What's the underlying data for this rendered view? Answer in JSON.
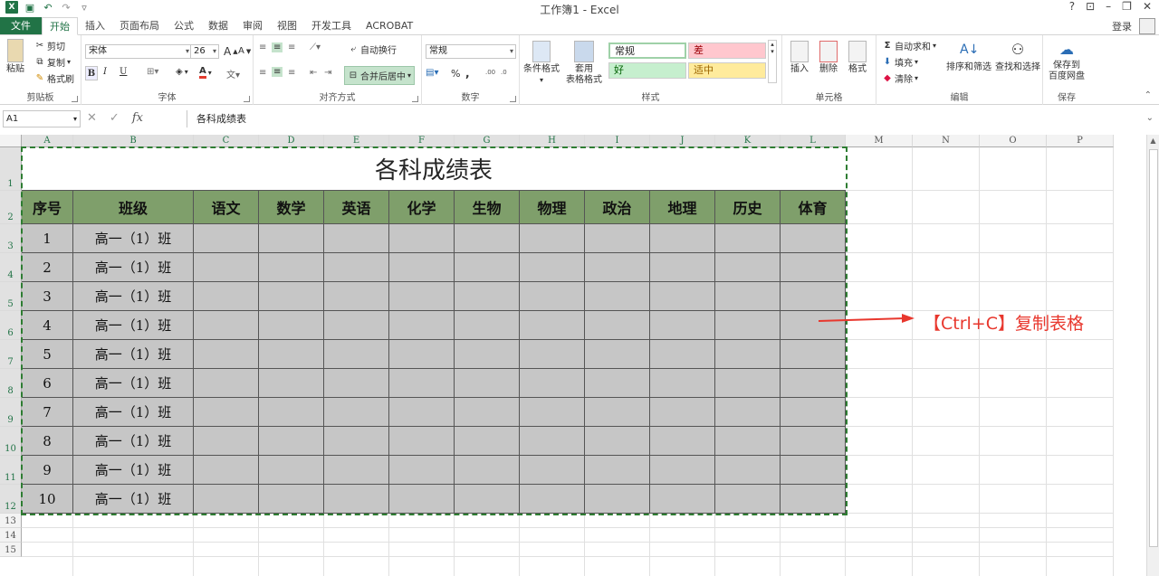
{
  "window": {
    "title": "工作簿1 - Excel",
    "controls": [
      "?",
      "⊡",
      "–",
      "❐",
      "✕"
    ]
  },
  "tabs": {
    "file": "文件",
    "items": [
      "开始",
      "插入",
      "页面布局",
      "公式",
      "数据",
      "审阅",
      "视图",
      "开发工具",
      "ACROBAT"
    ],
    "active": "开始",
    "signin": "登录"
  },
  "ribbon": {
    "clipboard": {
      "paste": "粘贴",
      "cut": "剪切",
      "copy": "复制",
      "format_painter": "格式刷",
      "label": "剪贴板"
    },
    "font": {
      "name": "宋体",
      "size": "26",
      "grow": "A",
      "shrink": "A",
      "bold": "B",
      "italic": "I",
      "underline": "U",
      "label": "字体"
    },
    "alignment": {
      "wrap": "自动换行",
      "merge": "合并后居中",
      "label": "对齐方式"
    },
    "number": {
      "format": "常规",
      "percent": "%",
      "comma": ",",
      "label": "数字"
    },
    "styles": {
      "conditional": "条件格式",
      "table_format_1": "套用",
      "table_format_2": "表格格式",
      "normal": "常规",
      "bad": "差",
      "good": "好",
      "neutral": "适中",
      "label": "样式"
    },
    "cells": {
      "insert": "插入",
      "delete": "删除",
      "format": "格式",
      "label": "单元格"
    },
    "editing": {
      "autosum": "自动求和",
      "fill": "填充",
      "clear": "清除",
      "sort": "排序和筛选",
      "find": "查找和选择",
      "label": "编辑"
    },
    "save": {
      "save_1": "保存到",
      "save_2": "百度网盘",
      "label": "保存"
    }
  },
  "formula_bar": {
    "name_box": "A1",
    "cancel": "✕",
    "enter": "✓",
    "fx": "fx",
    "content": "各科成绩表"
  },
  "columns": [
    "A",
    "B",
    "C",
    "D",
    "E",
    "F",
    "G",
    "H",
    "I",
    "J",
    "K",
    "L",
    "M",
    "N",
    "O",
    "P"
  ],
  "rows": [
    "1",
    "2",
    "3",
    "4",
    "5",
    "6",
    "7",
    "8",
    "9",
    "10",
    "11",
    "12",
    "13",
    "14",
    "15"
  ],
  "sheet": {
    "title": "各科成绩表",
    "headers": [
      "序号",
      "班级",
      "语文",
      "数学",
      "英语",
      "化学",
      "生物",
      "物理",
      "政治",
      "地理",
      "历史",
      "体育"
    ],
    "rows": [
      [
        "1",
        "高一（1）班"
      ],
      [
        "2",
        "高一（1）班"
      ],
      [
        "3",
        "高一（1）班"
      ],
      [
        "4",
        "高一（1）班"
      ],
      [
        "5",
        "高一（1）班"
      ],
      [
        "6",
        "高一（1）班"
      ],
      [
        "7",
        "高一（1）班"
      ],
      [
        "8",
        "高一（1）班"
      ],
      [
        "9",
        "高一（1）班"
      ],
      [
        "10",
        "高一（1）班"
      ]
    ],
    "header_color": "#7f9f6b",
    "body_color": "#c6c6c6"
  },
  "annotation": {
    "text": "【Ctrl+C】复制表格",
    "color": "#e8372d"
  },
  "accent": "#217346"
}
